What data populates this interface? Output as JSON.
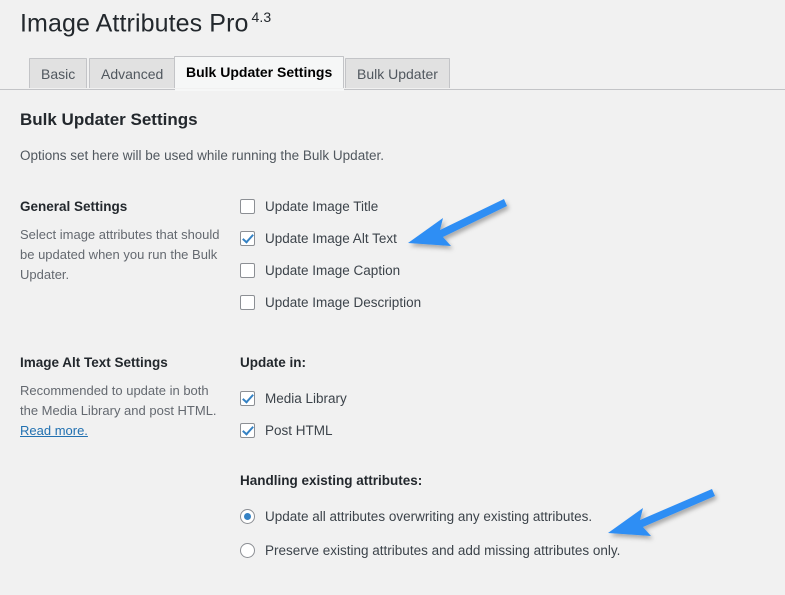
{
  "header": {
    "title": "Image Attributes Pro",
    "version": "4.3"
  },
  "tabs": [
    {
      "label": "Basic",
      "active": false
    },
    {
      "label": "Advanced",
      "active": false
    },
    {
      "label": "Bulk Updater Settings",
      "active": true
    },
    {
      "label": "Bulk Updater",
      "active": false
    }
  ],
  "page": {
    "heading": "Bulk Updater Settings",
    "intro": "Options set here will be used while running the Bulk Updater."
  },
  "general_settings": {
    "heading": "General Settings",
    "description": "Select image attributes that should be updated when you run the Bulk Updater.",
    "options": [
      {
        "label": "Update Image Title",
        "checked": false
      },
      {
        "label": "Update Image Alt Text",
        "checked": true
      },
      {
        "label": "Update Image Caption",
        "checked": false
      },
      {
        "label": "Update Image Description",
        "checked": false
      }
    ]
  },
  "alt_text_settings": {
    "heading": "Image Alt Text Settings",
    "description": "Recommended to update in both the Media Library and post HTML.",
    "link_label": "Read more.",
    "update_in_label": "Update in:",
    "update_in_options": [
      {
        "label": "Media Library",
        "checked": true
      },
      {
        "label": "Post HTML",
        "checked": true
      }
    ],
    "handling_label": "Handling existing attributes:",
    "handling_options": [
      {
        "label": "Update all attributes overwriting any existing attributes.",
        "checked": true
      },
      {
        "label": "Preserve existing attributes and add missing attributes only.",
        "checked": false
      }
    ]
  },
  "annotations": {
    "arrow_color": "#2f8ef4",
    "arrows": [
      {
        "name": "arrow-to-update-image-alt-text"
      },
      {
        "name": "arrow-to-update-all-attributes"
      }
    ]
  },
  "colors": {
    "background": "#f1f1f1",
    "accent": "#3582c4",
    "link": "#2271b1",
    "tab_inactive": "#e1e1e1",
    "tab_active": "#f6f7f7"
  }
}
